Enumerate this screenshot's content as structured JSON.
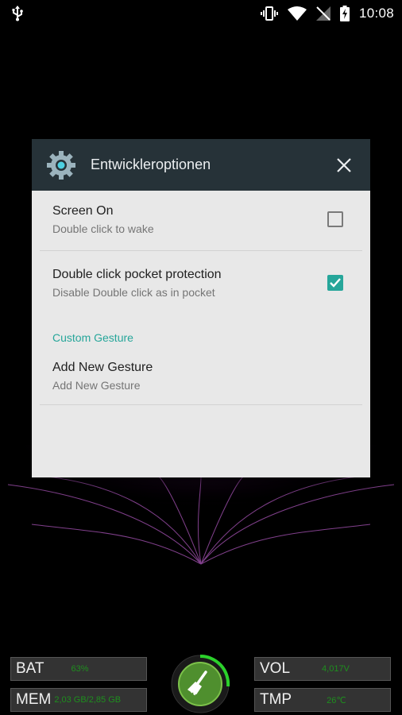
{
  "status_bar": {
    "time": "10:08",
    "icons": [
      "usb-icon",
      "vibrate-icon",
      "wifi-icon",
      "no-sim-icon",
      "battery-charging-icon"
    ]
  },
  "dialog": {
    "title": "Entwickleroptionen",
    "settings_icon": "gear-icon",
    "close_icon": "close-icon",
    "prefs": [
      {
        "title": "Screen On",
        "summary": "Double click to wake",
        "checked": false
      },
      {
        "title": "Double click pocket protection",
        "summary": "Disable Double click as in pocket",
        "checked": true
      }
    ],
    "category": "Custom Gesture",
    "gesture_pref": {
      "title": "Add New Gesture",
      "summary": "Add New Gesture"
    }
  },
  "widgets": {
    "bat": {
      "label": "BAT",
      "value": "63%"
    },
    "mem": {
      "label": "MEM",
      "value": "2,03 GB/2,85 GB"
    },
    "vol": {
      "label": "VOL",
      "value": "4,017V"
    },
    "tmp": {
      "label": "TMP",
      "value": "26℃"
    },
    "clean_button_icon": "broom-icon",
    "accent_color": "#1e8f1e"
  }
}
